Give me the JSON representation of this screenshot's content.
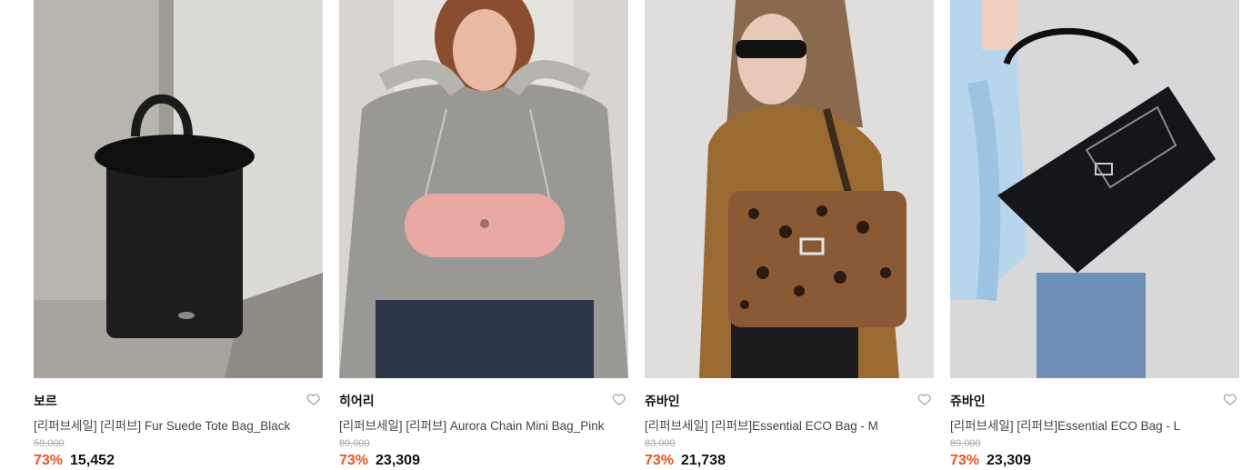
{
  "products": [
    {
      "brand": "보르",
      "title": "[리퍼브세일] [리퍼브] Fur Suede Tote Bag_Black",
      "original_price": "59,000",
      "discount_rate": "73%",
      "sale_price": "15,452",
      "image_subject": "black-fur-tote-bag"
    },
    {
      "brand": "히어리",
      "title": "[리퍼브세일] [리퍼브] Aurora Chain Mini Bag_Pink",
      "original_price": "89,000",
      "discount_rate": "73%",
      "sale_price": "23,309",
      "image_subject": "model-with-pink-chain-bag"
    },
    {
      "brand": "쥬바인",
      "title": "[리퍼브세일] [리퍼브]Essential ECO Bag - M",
      "original_price": "83,000",
      "discount_rate": "73%",
      "sale_price": "21,738",
      "image_subject": "model-with-leopard-tote"
    },
    {
      "brand": "쥬바인",
      "title": "[리퍼브세일] [리퍼브]Essential ECO Bag - L",
      "original_price": "89,000",
      "discount_rate": "73%",
      "sale_price": "23,309",
      "image_subject": "model-with-black-canvas-tote"
    }
  ],
  "colors": {
    "discount": "#f1501f",
    "brand_text": "#111111",
    "title_text": "#444444",
    "strike_price": "#aaaaaa"
  }
}
